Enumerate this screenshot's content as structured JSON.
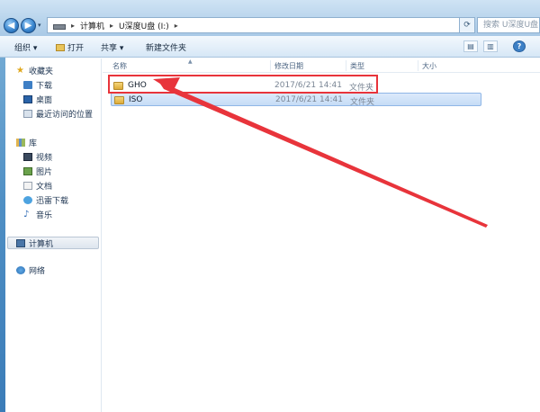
{
  "address_bar": {
    "path": [
      "计算机",
      "U深度U盘 (I:)"
    ],
    "search_placeholder": "搜索 U深度U盘 (I:)"
  },
  "toolbar": {
    "organize": "组织 ▾",
    "open": "打开",
    "share": "共享 ▾",
    "new_folder": "新建文件夹"
  },
  "nav": {
    "favorites": "收藏夹",
    "downloads": "下载",
    "desktop": "桌面",
    "recent": "最近访问的位置",
    "libraries": "库",
    "videos": "视频",
    "pictures": "图片",
    "documents": "文档",
    "thunder": "迅雷下载",
    "music": "音乐",
    "computer": "计算机",
    "network": "网络"
  },
  "columns": {
    "name": "名称",
    "date": "修改日期",
    "type": "类型",
    "size": "大小"
  },
  "files": [
    {
      "name": "GHO",
      "date": "2017/6/21 14:41",
      "type": "文件夹"
    },
    {
      "name": "ISO",
      "date": "2017/6/21 14:41",
      "type": "文件夹"
    }
  ],
  "colors": {
    "annotation": "#e8343b",
    "selection": "#c6dcf6"
  }
}
